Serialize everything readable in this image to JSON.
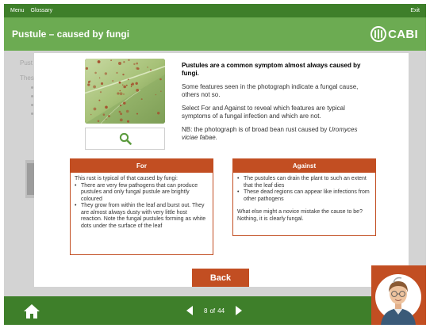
{
  "topbar": {
    "menu": "Menu",
    "glossary": "Glossary",
    "exit": "Exit"
  },
  "title": "Pustule – caused by fungi",
  "brand": "CABI",
  "background": {
    "text1": "Pust",
    "text2": "Thes"
  },
  "modal": {
    "heading": "Pustules are a common symptom almost always caused by fungi.",
    "p1": "Some features seen in the photograph indicate a fungal cause, others not so.",
    "p2": "Select For and Against to reveal which features are typical symptoms of a fungal infection and which are not.",
    "nb_prefix": "NB: the photograph is of broad bean rust caused by ",
    "nb_species": "Uromyces viciae fabae.",
    "zoom_icon": "magnifier-icon"
  },
  "for_panel": {
    "title": "For",
    "intro": "This rust is typical of that caused by fungi:",
    "items": [
      "There are very few pathogens that can produce pustules and only fungal pustule are brightly coloured",
      "They grow from within the leaf and burst out. They are almost always dusty with very little host reaction. Note the fungal pustules forming as white dots under the surface of the leaf"
    ]
  },
  "against_panel": {
    "title": "Against",
    "items": [
      "The pustules can drain the plant to such an extent that the leaf dies",
      "These dead regions can appear like infections from other pathogens"
    ],
    "note": "What else might a novice mistake the cause to be? Nothing, it is clearly fungal."
  },
  "back_label": "Back",
  "pager": {
    "current": "8",
    "separator": "of",
    "total": "44"
  },
  "colors": {
    "dark_green": "#3e7f2a",
    "light_green": "#6cab52",
    "accent": "#c24e22"
  }
}
